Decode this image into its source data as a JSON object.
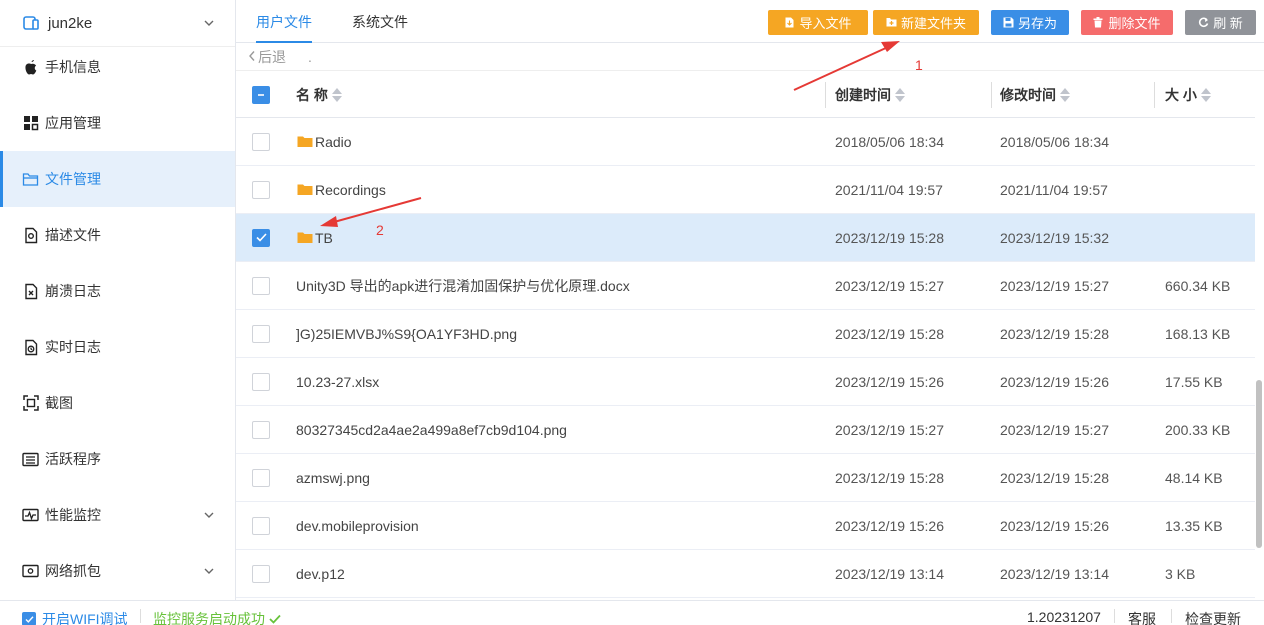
{
  "device": {
    "name": "jun2ke",
    "icon": "phone-device-icon"
  },
  "sidebar": {
    "items": [
      {
        "label": "手机信息",
        "icon": "apple-icon"
      },
      {
        "label": "应用管理",
        "icon": "apps-grid-icon"
      },
      {
        "label": "文件管理",
        "icon": "folder-icon",
        "active": true
      },
      {
        "label": "描述文件",
        "icon": "profile-file-icon"
      },
      {
        "label": "崩溃日志",
        "icon": "crash-log-icon"
      },
      {
        "label": "实时日志",
        "icon": "realtime-log-icon"
      },
      {
        "label": "截图",
        "icon": "screenshot-icon"
      },
      {
        "label": "活跃程序",
        "icon": "process-list-icon"
      },
      {
        "label": "性能监控",
        "icon": "performance-icon",
        "expandable": true
      },
      {
        "label": "网络抓包",
        "icon": "network-capture-icon",
        "expandable": true
      }
    ]
  },
  "tabs": [
    {
      "label": "用户文件",
      "active": true
    },
    {
      "label": "系统文件"
    }
  ],
  "toolbar": {
    "import": "导入文件",
    "new_folder": "新建文件夹",
    "save_as": "另存为",
    "delete": "删除文件",
    "refresh": "刷 新"
  },
  "nav": {
    "back": "后退",
    "path": "."
  },
  "table": {
    "headers": {
      "name": "名 称",
      "created": "创建时间",
      "modified": "修改时间",
      "size": "大 小"
    },
    "rows": [
      {
        "name": "Radio",
        "type": "folder",
        "created": "2018/05/06 18:34",
        "modified": "2018/05/06 18:34",
        "size": "",
        "checked": false
      },
      {
        "name": "Recordings",
        "type": "folder",
        "created": "2021/11/04 19:57",
        "modified": "2021/11/04 19:57",
        "size": "",
        "checked": false
      },
      {
        "name": "TB",
        "type": "folder",
        "created": "2023/12/19 15:28",
        "modified": "2023/12/19 15:32",
        "size": "",
        "checked": true
      },
      {
        "name": " Unity3D 导出的apk进行混淆加固保护与优化原理.docx",
        "type": "file",
        "created": "2023/12/19 15:27",
        "modified": "2023/12/19 15:27",
        "size": "660.34 KB",
        "checked": false
      },
      {
        "name": "]G)25IEMVBJ%S9{OA1YF3HD.png",
        "type": "file",
        "created": "2023/12/19 15:28",
        "modified": "2023/12/19 15:28",
        "size": "168.13 KB",
        "checked": false
      },
      {
        "name": "10.23-27.xlsx",
        "type": "file",
        "created": "2023/12/19 15:26",
        "modified": "2023/12/19 15:26",
        "size": "17.55 KB",
        "checked": false
      },
      {
        "name": "80327345cd2a4ae2a499a8ef7cb9d104.png",
        "type": "file",
        "created": "2023/12/19 15:27",
        "modified": "2023/12/19 15:27",
        "size": "200.33 KB",
        "checked": false
      },
      {
        "name": "azmswj.png",
        "type": "file",
        "created": "2023/12/19 15:28",
        "modified": "2023/12/19 15:28",
        "size": "48.14 KB",
        "checked": false
      },
      {
        "name": "dev.mobileprovision",
        "type": "file",
        "created": "2023/12/19 15:26",
        "modified": "2023/12/19 15:26",
        "size": "13.35 KB",
        "checked": false
      },
      {
        "name": "dev.p12",
        "type": "file",
        "created": "2023/12/19 13:14",
        "modified": "2023/12/19 13:14",
        "size": "3 KB",
        "checked": false
      }
    ]
  },
  "status": {
    "wifi_debug": "开启WIFI调试",
    "wifi_checked": true,
    "monitor": "监控服务启动成功",
    "version": "1.20231207",
    "support": "客服",
    "check_update": "检查更新"
  },
  "annotations": {
    "one": "1",
    "two": "2"
  },
  "colors": {
    "accent": "#2b8ae6",
    "orange": "#f5a623",
    "blue": "#3a8ee6",
    "red": "#f56c6c",
    "gray": "#909399",
    "success": "#67c23a",
    "annotation": "#e53935",
    "folder": "#f5a623",
    "selected_row": "#dcebfa"
  }
}
